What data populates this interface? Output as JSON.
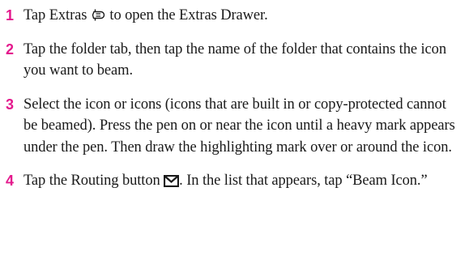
{
  "steps": [
    {
      "number": "1",
      "text_before_icon": "Tap Extras ",
      "icon": "extras-drawer-icon",
      "text_after_icon": " to open the Extras Drawer."
    },
    {
      "number": "2",
      "text": "Tap the folder tab, then tap the name of the folder that contains the icon you want to beam."
    },
    {
      "number": "3",
      "text": "Select the icon or icons (icons that are built in or copy-protected cannot be beamed). Press the pen on or near the icon until a heavy mark appears under the pen. Then draw the highlighting mark over or around the icon."
    },
    {
      "number": "4",
      "text_before_icon": "Tap the Routing button ",
      "icon": "routing-envelope-icon",
      "text_after_icon": ". In the list that appears, tap “Beam Icon.”"
    }
  ],
  "colors": {
    "step_number": "#e4198d",
    "text": "#1a1a1a"
  }
}
